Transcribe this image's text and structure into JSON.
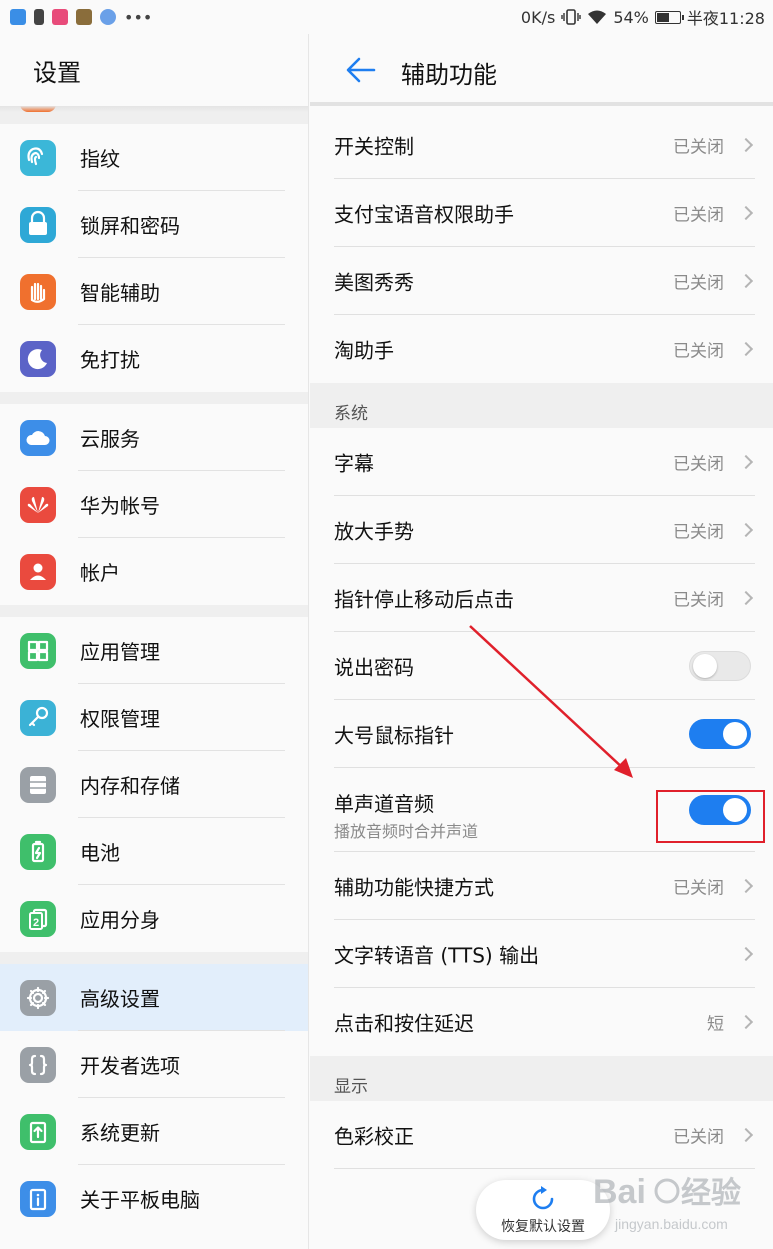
{
  "status_bar": {
    "speed": "0K/s",
    "battery_percent": "54%",
    "battery_level": 0.54,
    "time": "半夜11:28"
  },
  "left_pane": {
    "title": "设置",
    "groups": [
      [
        {
          "label": "指纹",
          "icon": "fingerprint-icon",
          "color": "#3bb7d8"
        },
        {
          "label": "锁屏和密码",
          "icon": "lock-icon",
          "color": "#2ea8d6"
        },
        {
          "label": "智能辅助",
          "icon": "hand-icon",
          "color": "#f0702e"
        },
        {
          "label": "免打扰",
          "icon": "moon-icon",
          "color": "#5b63c7"
        }
      ],
      [
        {
          "label": "云服务",
          "icon": "cloud-icon",
          "color": "#3d8ee8"
        },
        {
          "label": "华为帐号",
          "icon": "huawei-icon",
          "color": "#ea4a3e"
        },
        {
          "label": "帐户",
          "icon": "account-icon",
          "color": "#ea4a3e"
        }
      ],
      [
        {
          "label": "应用管理",
          "icon": "apps-icon",
          "color": "#3fbf6b"
        },
        {
          "label": "权限管理",
          "icon": "key-icon",
          "color": "#3bb2d6"
        },
        {
          "label": "内存和存储",
          "icon": "storage-icon",
          "color": "#9aa0a6"
        },
        {
          "label": "电池",
          "icon": "battery-icon",
          "color": "#3fbf6b"
        },
        {
          "label": "应用分身",
          "icon": "twin-app-icon",
          "color": "#3fbf6b"
        }
      ],
      [
        {
          "label": "高级设置",
          "icon": "gear-icon",
          "color": "#9aa0a6",
          "selected": true
        },
        {
          "label": "开发者选项",
          "icon": "braces-icon",
          "color": "#9aa0a6"
        },
        {
          "label": "系统更新",
          "icon": "update-icon",
          "color": "#3fbf6b"
        },
        {
          "label": "关于平板电脑",
          "icon": "info-icon",
          "color": "#3d8ee8"
        }
      ]
    ]
  },
  "right_pane": {
    "title": "辅助功能",
    "rows_top": [
      {
        "title": "开关控制",
        "value": "已关闭"
      },
      {
        "title": "支付宝语音权限助手",
        "value": "已关闭"
      },
      {
        "title": "美图秀秀",
        "value": "已关闭"
      },
      {
        "title": "淘助手",
        "value": "已关闭"
      }
    ],
    "section_system": "系统",
    "rows_system": [
      {
        "title": "字幕",
        "value": "已关闭"
      },
      {
        "title": "放大手势",
        "value": "已关闭"
      },
      {
        "title": "指针停止移动后点击",
        "value": "已关闭"
      }
    ],
    "toggles": [
      {
        "title": "说出密码",
        "on": false
      },
      {
        "title": "大号鼠标指针",
        "on": true
      }
    ],
    "mono_audio": {
      "title": "单声道音频",
      "subtitle": "播放音频时合并声道",
      "on": true
    },
    "rows_system_2": [
      {
        "title": "辅助功能快捷方式",
        "value": "已关闭"
      },
      {
        "title": "文字转语音 (TTS) 输出",
        "value": ""
      },
      {
        "title": "点击和按住延迟",
        "value": "短"
      }
    ],
    "section_display": "显示",
    "rows_display": [
      {
        "title": "色彩校正",
        "value": "已关闭"
      }
    ],
    "restore_button": "恢复默认设置"
  },
  "watermark": {
    "brand": "Baidu",
    "sub": "经验",
    "url": "jingyan.baidu.com"
  },
  "colors": {
    "accent": "#1e7ef0",
    "annotation": "#e0202b",
    "selected_bg": "#e2eefb"
  }
}
